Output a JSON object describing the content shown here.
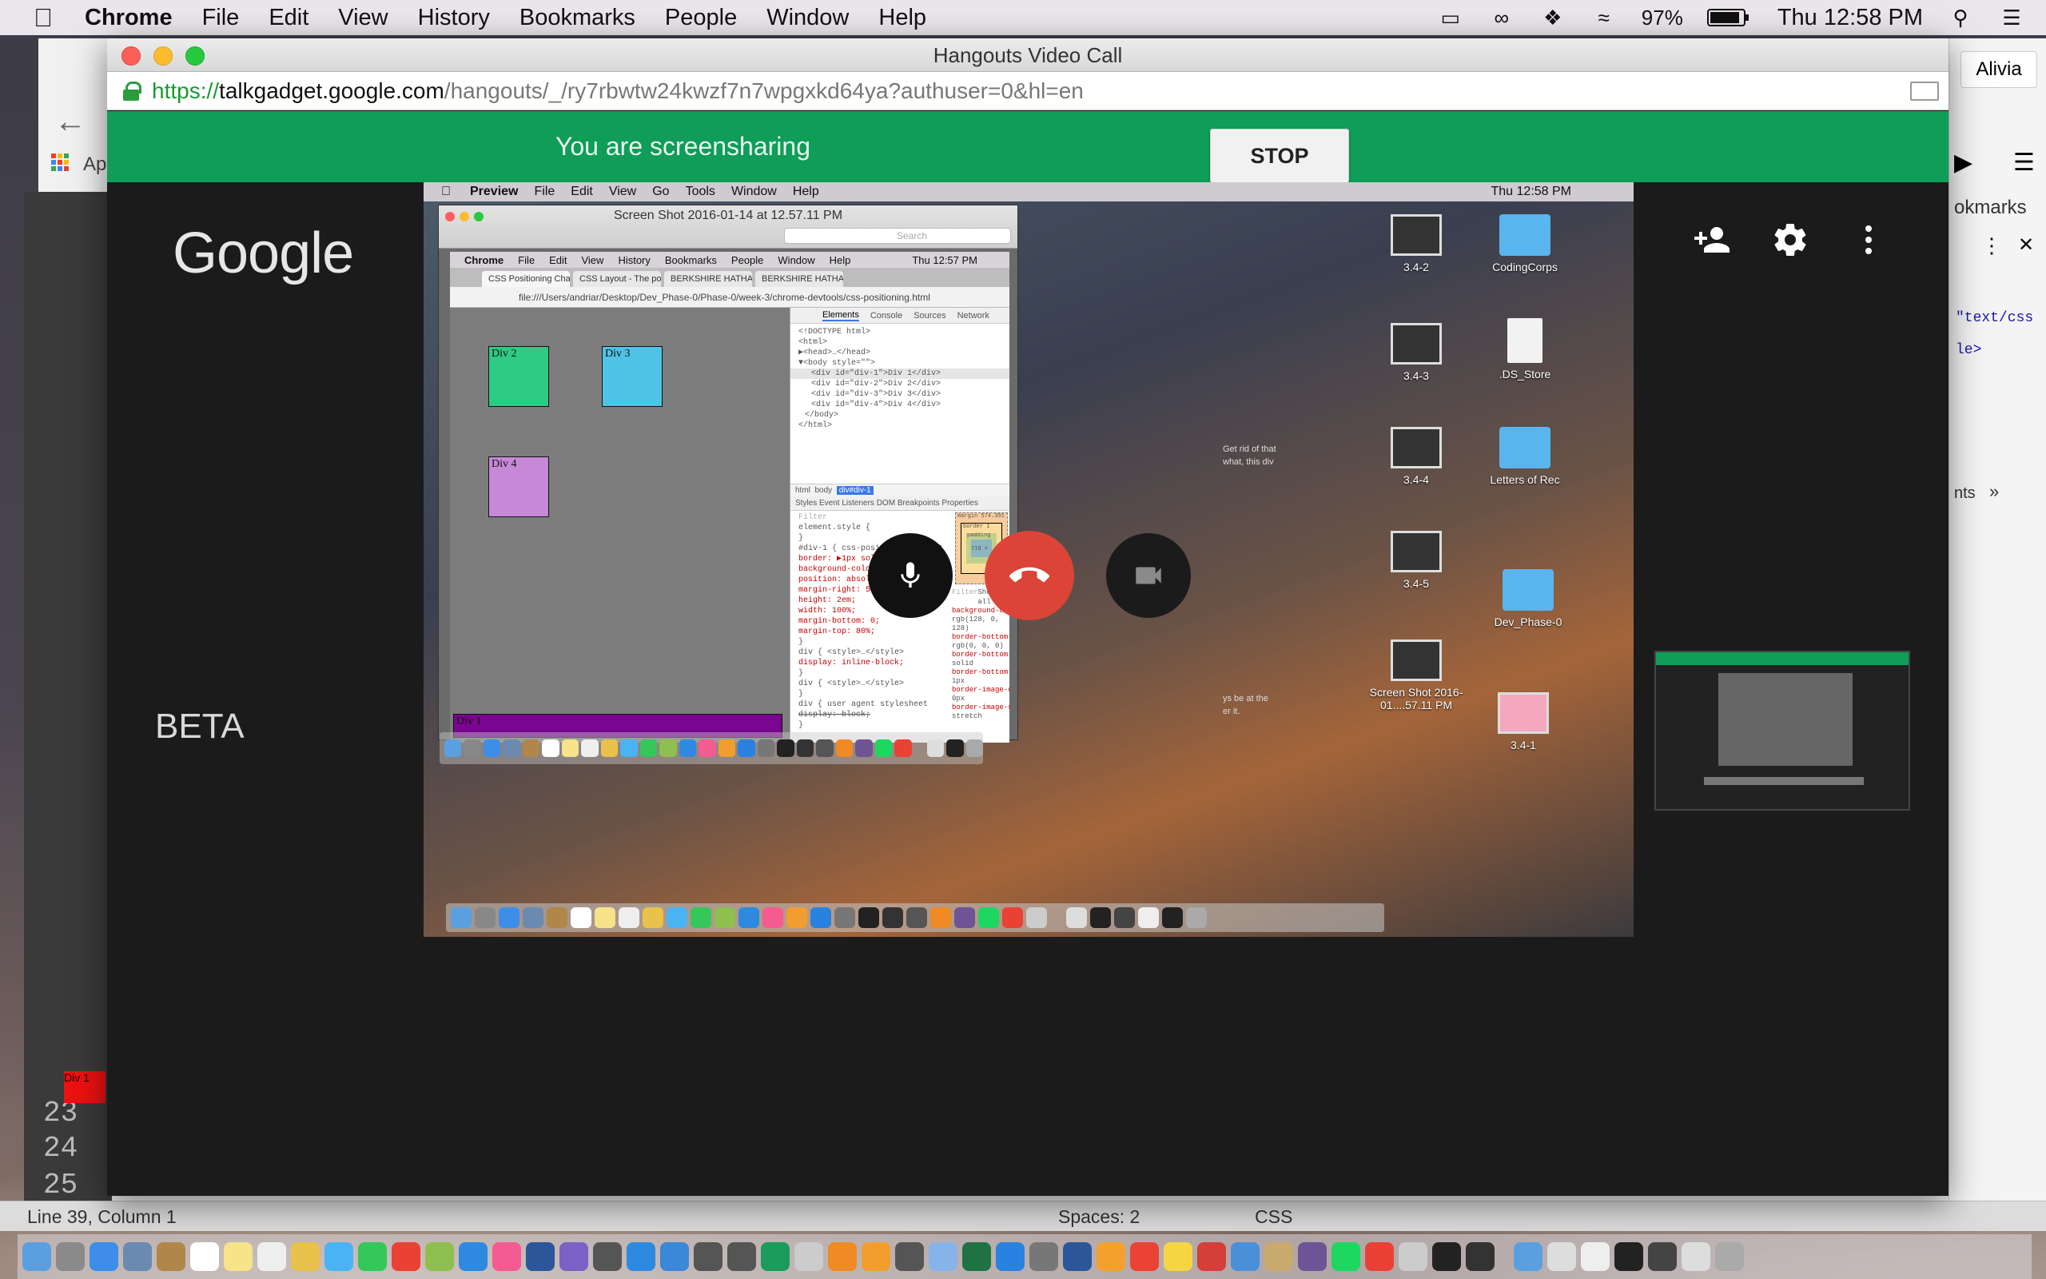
{
  "menubar": {
    "app": "Chrome",
    "items": [
      "File",
      "Edit",
      "View",
      "History",
      "Bookmarks",
      "People",
      "Window",
      "Help"
    ],
    "battery": "97%",
    "clock": "Thu 12:58 PM"
  },
  "background_chrome": {
    "profile": "Alivia",
    "bookmarks_bar_left": "Ap",
    "bookmarks_bar_right": "okmarks",
    "code_snippets": [
      "\"text/css",
      "le>"
    ],
    "panel_label": "nts"
  },
  "editor": {
    "line_numbers": [
      "23",
      "24",
      "25"
    ],
    "div1_label": "Div 1",
    "status_position": "Line 39, Column 1",
    "status_spaces": "Spaces: 2",
    "status_syntax": "CSS"
  },
  "hangouts": {
    "window_title": "Hangouts Video Call",
    "url": {
      "scheme": "https://",
      "host": "talkgadget.google.com",
      "path": "/hangouts/_/ry7rbwtw24kwzf7n7wpgxkd64ya?authuser=0&hl=en"
    },
    "banner_text": "You are screensharing",
    "stop_label": "STOP",
    "logo": "Google",
    "beta": "BETA",
    "icons": [
      "add-person-icon",
      "gear-icon",
      "more-vert-icon",
      "mic-icon",
      "hangup-icon",
      "camera-icon"
    ],
    "colors": {
      "banner": "#0f9d58",
      "hangup": "#db4437",
      "background": "#1b1b1b"
    }
  },
  "shared_screen": {
    "menubar": {
      "app": "Preview",
      "items": [
        "File",
        "Edit",
        "View",
        "Go",
        "Tools",
        "Window",
        "Help"
      ],
      "clock": "Thu 12:58 PM"
    },
    "preview_title": "Screen Shot 2016-01-14 at 12.57.11 PM",
    "preview_search": "Search",
    "inner_chrome": {
      "menubar": [
        "Chrome",
        "File",
        "Edit",
        "View",
        "History",
        "Bookmarks",
        "People",
        "Window",
        "Help"
      ],
      "clock": "Thu 12:57 PM",
      "tabs": [
        "CSS Positioning Challenge",
        "CSS Layout - The position",
        "BERKSHIRE HATHAWAY IN",
        "BERKSHIRE HATHAWAY IN"
      ],
      "address": "file:///Users/andriar/Desktop/Dev_Phase-0/Phase-0/week-3/chrome-devtools/css-positioning.html",
      "boxes": [
        "Div 2",
        "Div 3",
        "Div 4"
      ],
      "bar": "Div 1"
    },
    "devtools": {
      "tabs": [
        "Elements",
        "Console",
        "Sources",
        "Network"
      ],
      "dom_lines": [
        "<!DOCTYPE html>",
        "<html>",
        "▶<head>…</head>",
        "▼<body style=\"\">",
        "<div id=\"div-1\">Div 1</div>",
        "<div id=\"div-2\">Div 2</div>",
        "<div id=\"div-3\">Div 3</div>",
        "<div id=\"div-4\">Div 4</div>",
        "</body>",
        "</html>"
      ],
      "crumbs": [
        "html",
        "body",
        "div#div-1"
      ],
      "subtabs": "Styles   Event Listeners   DOM Breakpoints   Properties",
      "style_lines": [
        "Filter",
        "element.style {",
        "}",
        "#div-1 {   css-positioning.css:9",
        "  border: ▶1px solid ■black;",
        "  background-color: ■purple;",
        "  position: absolute;",
        "  margin-right: 5em;",
        "  height: 2em;",
        "  width: 100%;",
        "  margin-bottom: 0;",
        "  margin-top: 80%;",
        "}",
        "div {          <style>…</style>",
        "  display: inline-block;",
        "}",
        "div {          <style>…</style>",
        "}",
        "div {   user agent stylesheet",
        "  display: block;",
        "}"
      ],
      "box_model": {
        "margin": "margin   574.391",
        "border": "border  1",
        "padding": "padding -",
        "content": "718 × 32"
      },
      "computed": [
        "background-color",
        "rgb(128, 0, 128)",
        "border-bottom-color",
        "rgb(0, 0, 0)",
        "border-bottom-style",
        "solid",
        "border-bottom-width",
        "1px",
        "border-image-outset",
        "0px",
        "border-image-repeat",
        "stretch"
      ],
      "filter_label": "Filter",
      "show_all": "Show all"
    },
    "side_text": [
      "Get rid of that",
      "what, this div",
      "ys be at the",
      "er it."
    ],
    "desktop_icons": [
      {
        "label": "3.4-2",
        "kind": "thumb"
      },
      {
        "label": "CodingCorps",
        "kind": "folder"
      },
      {
        "label": "3.4-3",
        "kind": "thumb"
      },
      {
        "label": ".DS_Store",
        "kind": "file"
      },
      {
        "label": "3.4-4",
        "kind": "thumb"
      },
      {
        "label": "Letters of Rec",
        "kind": "folder"
      },
      {
        "label": "3.4-5",
        "kind": "thumb"
      },
      {
        "label": "Dev_Phase-0",
        "kind": "folder"
      },
      {
        "label": "Screen Shot 2016-01....57.11 PM",
        "kind": "thumb"
      },
      {
        "label": "3.4-1",
        "kind": "thumb"
      }
    ]
  }
}
